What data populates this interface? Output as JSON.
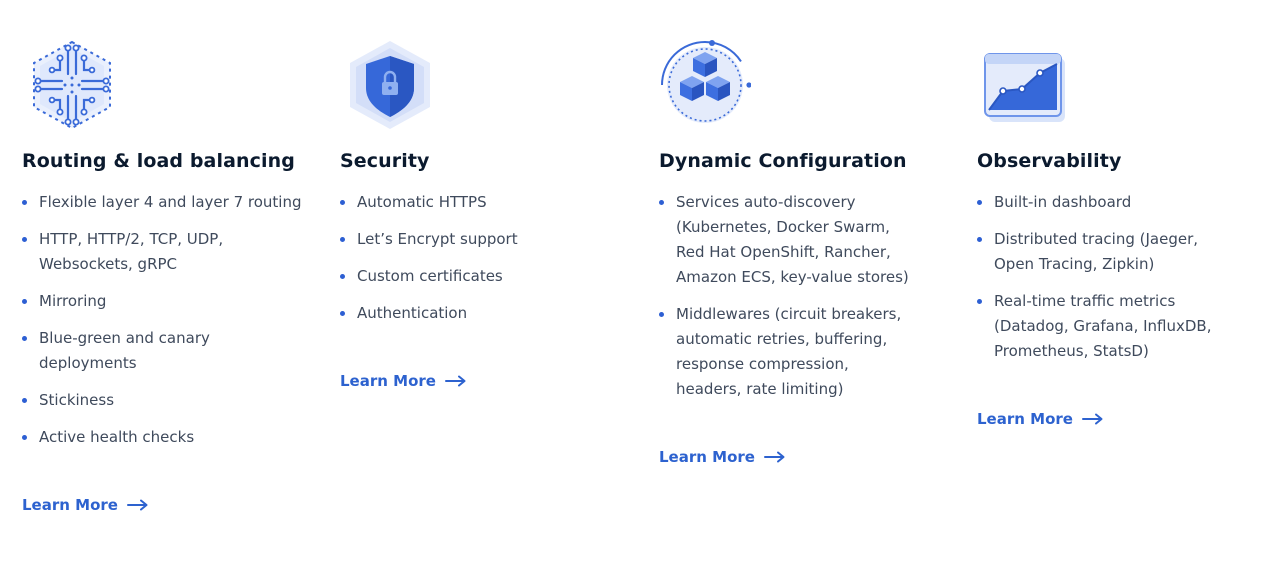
{
  "features": [
    {
      "icon": "circuit-hexagon-icon",
      "title": "Routing & load balancing",
      "items": [
        "Flexible layer 4 and layer 7 routing",
        "HTTP, HTTP/2, TCP, UDP, Websockets, gRPC",
        "Mirroring",
        "Blue-green and canary deployments",
        "Stickiness",
        "Active health checks"
      ],
      "link": "Learn More"
    },
    {
      "icon": "shield-lock-icon",
      "title": "Security",
      "items": [
        "Automatic HTTPS",
        "Let’s Encrypt support",
        "Custom certificates",
        "Authentication"
      ],
      "link": "Learn More"
    },
    {
      "icon": "cubes-cycle-icon",
      "title": "Dynamic Configuration",
      "items": [
        "Services auto-discovery (Kubernetes, Docker Swarm, Red Hat OpenShift, Rancher, Amazon ECS, key-value stores)",
        "Middlewares (circuit breakers, automatic retries, buffering, response compression, headers, rate limiting)"
      ],
      "link": "Learn More"
    },
    {
      "icon": "line-chart-icon",
      "title": "Observability",
      "items": [
        "Built-in dashboard",
        "Distributed tracing (Jaeger, Open Tracing, Zipkin)",
        "Real-time traffic metrics (Datadog, Grafana, InfluxDB, Prometheus, StatsD)"
      ],
      "link": "Learn More"
    }
  ],
  "colors": {
    "accent": "#2d62cf",
    "bullet": "#2d5fd3",
    "title": "#0b1a2e",
    "text": "#3f4a5c"
  }
}
